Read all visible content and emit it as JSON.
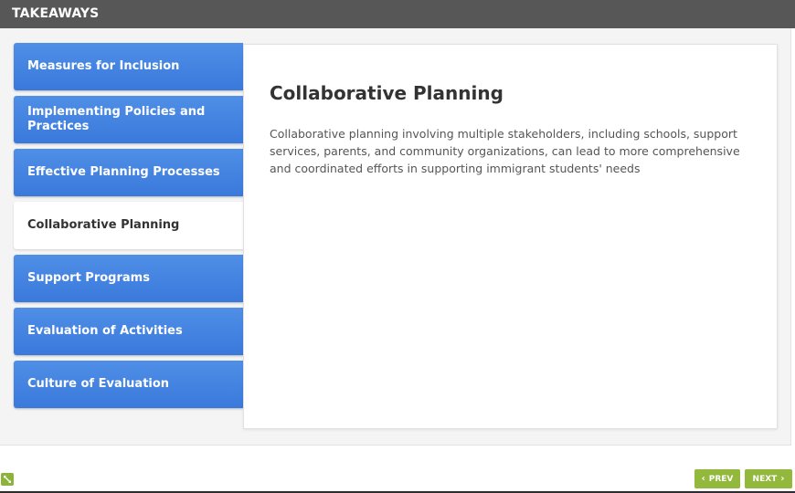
{
  "header": {
    "title": "TAKEAWAYS"
  },
  "tabs": [
    {
      "label": "Measures for Inclusion"
    },
    {
      "label": "Implementing Policies and Practices"
    },
    {
      "label": "Effective Planning Processes"
    },
    {
      "label": "Collaborative Planning"
    },
    {
      "label": "Support Programs"
    },
    {
      "label": "Evaluation of Activities"
    },
    {
      "label": "Culture of Evaluation"
    }
  ],
  "active_tab": "Collaborative Planning",
  "content": {
    "heading": "Collaborative Planning",
    "body": "Collaborative planning involving multiple stakeholders, including schools, support services, parents, and community organizations, can lead to more comprehensive and coordinated efforts in supporting immigrant students' needs"
  },
  "nav": {
    "prev_label": "PREV",
    "next_label": "NEXT"
  },
  "colors": {
    "tab_blue": "#3a79db",
    "nav_green": "#92b83c",
    "header_gray": "#575757"
  },
  "icons": {
    "expand": "expand-arrows-icon",
    "prev": "chevron-left-icon",
    "next": "chevron-right-icon"
  }
}
